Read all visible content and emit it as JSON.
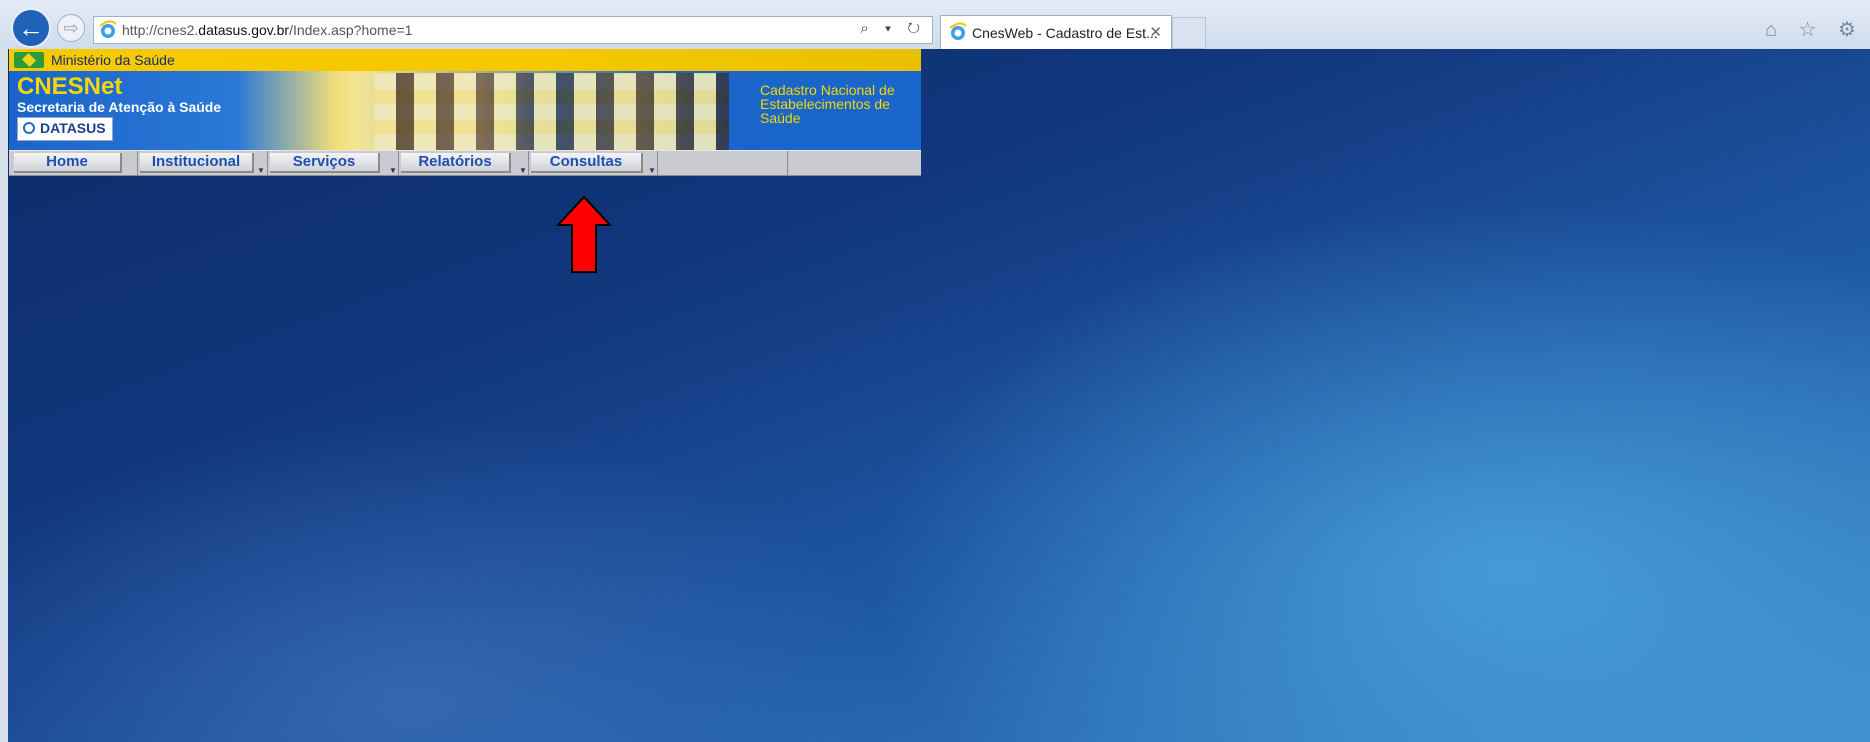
{
  "browser": {
    "url_prefix": "http://cnes2.",
    "url_domain": "datasus.gov.br",
    "url_suffix": "/Index.asp?home=1",
    "address_tools": "⌕ ▾ ↻",
    "tab_title": "CnesWeb - Cadastro de Est...",
    "tab_close": "✕",
    "back_icon": "←",
    "forward_icon": "⇨",
    "right_tools": "⌂ ☆ ⚙"
  },
  "header": {
    "ministry": "Ministério da Saúde",
    "title": "CNESNet",
    "subtitle": "Secretaria de Atenção à Saúde",
    "logo_text": "DATASUS",
    "tagline_line1": "Cadastro Nacional de",
    "tagline_line2": "Estabelecimentos de",
    "tagline_line3": "Saúde"
  },
  "menu": {
    "items": [
      {
        "label": "Home"
      },
      {
        "label": "Institucional"
      },
      {
        "label": "Serviços"
      },
      {
        "label": "Relatórios"
      },
      {
        "label": "Consultas"
      }
    ],
    "arrow": "▼"
  },
  "annotation": {
    "arrow_color": "#ff0000",
    "target": "Consultas"
  }
}
